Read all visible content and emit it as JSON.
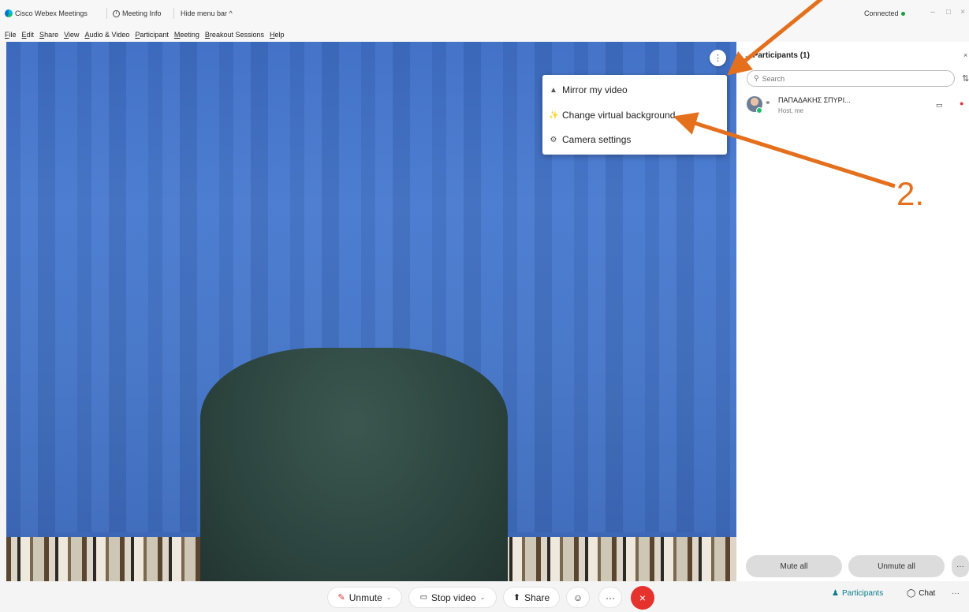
{
  "titlebar": {
    "app_name": "Cisco Webex Meetings",
    "meeting_info": "Meeting Info",
    "hide_menu": "Hide menu bar ^",
    "status": "Connected",
    "status_color": "#1c9e3b"
  },
  "menubar": {
    "items": [
      "File",
      "Edit",
      "Share",
      "View",
      "Audio & Video",
      "Participant",
      "Meeting",
      "Breakout Sessions",
      "Help"
    ]
  },
  "video_menu": {
    "items": [
      {
        "label": "Mirror my video",
        "icon": "mirror-icon"
      },
      {
        "label": "Change virtual background",
        "icon": "magic-wand-icon"
      },
      {
        "label": "Camera settings",
        "icon": "gear-icon"
      }
    ]
  },
  "participants_panel": {
    "title": "Participants (1)",
    "search_placeholder": "Search",
    "participants": [
      {
        "name": "ΠΑΠΑΔΑΚΗΣ ΣΠΥΡΙ...",
        "role": "Host, me"
      }
    ],
    "mute_all": "Mute all",
    "unmute_all": "Unmute all",
    "more": "···"
  },
  "controls": {
    "unmute": "Unmute",
    "stop_video": "Stop video",
    "share": "Share",
    "more": "···",
    "end_icon": "close-icon",
    "end_color": "#e5322d",
    "participants": "Participants",
    "chat": "Chat",
    "right_more": "···"
  },
  "annotation": {
    "step_label": "2.",
    "color": "#e4701e"
  }
}
